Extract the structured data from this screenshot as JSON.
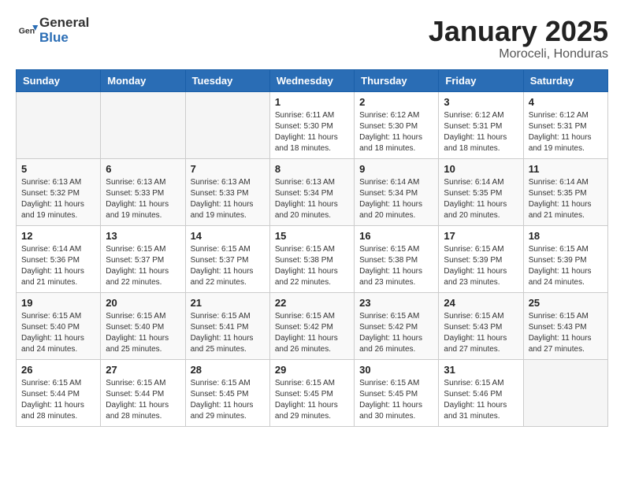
{
  "header": {
    "logo_general": "General",
    "logo_blue": "Blue",
    "month_title": "January 2025",
    "subtitle": "Moroceli, Honduras"
  },
  "weekdays": [
    "Sunday",
    "Monday",
    "Tuesday",
    "Wednesday",
    "Thursday",
    "Friday",
    "Saturday"
  ],
  "weeks": [
    [
      {
        "day": "",
        "info": ""
      },
      {
        "day": "",
        "info": ""
      },
      {
        "day": "",
        "info": ""
      },
      {
        "day": "1",
        "info": "Sunrise: 6:11 AM\nSunset: 5:30 PM\nDaylight: 11 hours and 18 minutes."
      },
      {
        "day": "2",
        "info": "Sunrise: 6:12 AM\nSunset: 5:30 PM\nDaylight: 11 hours and 18 minutes."
      },
      {
        "day": "3",
        "info": "Sunrise: 6:12 AM\nSunset: 5:31 PM\nDaylight: 11 hours and 18 minutes."
      },
      {
        "day": "4",
        "info": "Sunrise: 6:12 AM\nSunset: 5:31 PM\nDaylight: 11 hours and 19 minutes."
      }
    ],
    [
      {
        "day": "5",
        "info": "Sunrise: 6:13 AM\nSunset: 5:32 PM\nDaylight: 11 hours and 19 minutes."
      },
      {
        "day": "6",
        "info": "Sunrise: 6:13 AM\nSunset: 5:33 PM\nDaylight: 11 hours and 19 minutes."
      },
      {
        "day": "7",
        "info": "Sunrise: 6:13 AM\nSunset: 5:33 PM\nDaylight: 11 hours and 19 minutes."
      },
      {
        "day": "8",
        "info": "Sunrise: 6:13 AM\nSunset: 5:34 PM\nDaylight: 11 hours and 20 minutes."
      },
      {
        "day": "9",
        "info": "Sunrise: 6:14 AM\nSunset: 5:34 PM\nDaylight: 11 hours and 20 minutes."
      },
      {
        "day": "10",
        "info": "Sunrise: 6:14 AM\nSunset: 5:35 PM\nDaylight: 11 hours and 20 minutes."
      },
      {
        "day": "11",
        "info": "Sunrise: 6:14 AM\nSunset: 5:35 PM\nDaylight: 11 hours and 21 minutes."
      }
    ],
    [
      {
        "day": "12",
        "info": "Sunrise: 6:14 AM\nSunset: 5:36 PM\nDaylight: 11 hours and 21 minutes."
      },
      {
        "day": "13",
        "info": "Sunrise: 6:15 AM\nSunset: 5:37 PM\nDaylight: 11 hours and 22 minutes."
      },
      {
        "day": "14",
        "info": "Sunrise: 6:15 AM\nSunset: 5:37 PM\nDaylight: 11 hours and 22 minutes."
      },
      {
        "day": "15",
        "info": "Sunrise: 6:15 AM\nSunset: 5:38 PM\nDaylight: 11 hours and 22 minutes."
      },
      {
        "day": "16",
        "info": "Sunrise: 6:15 AM\nSunset: 5:38 PM\nDaylight: 11 hours and 23 minutes."
      },
      {
        "day": "17",
        "info": "Sunrise: 6:15 AM\nSunset: 5:39 PM\nDaylight: 11 hours and 23 minutes."
      },
      {
        "day": "18",
        "info": "Sunrise: 6:15 AM\nSunset: 5:39 PM\nDaylight: 11 hours and 24 minutes."
      }
    ],
    [
      {
        "day": "19",
        "info": "Sunrise: 6:15 AM\nSunset: 5:40 PM\nDaylight: 11 hours and 24 minutes."
      },
      {
        "day": "20",
        "info": "Sunrise: 6:15 AM\nSunset: 5:40 PM\nDaylight: 11 hours and 25 minutes."
      },
      {
        "day": "21",
        "info": "Sunrise: 6:15 AM\nSunset: 5:41 PM\nDaylight: 11 hours and 25 minutes."
      },
      {
        "day": "22",
        "info": "Sunrise: 6:15 AM\nSunset: 5:42 PM\nDaylight: 11 hours and 26 minutes."
      },
      {
        "day": "23",
        "info": "Sunrise: 6:15 AM\nSunset: 5:42 PM\nDaylight: 11 hours and 26 minutes."
      },
      {
        "day": "24",
        "info": "Sunrise: 6:15 AM\nSunset: 5:43 PM\nDaylight: 11 hours and 27 minutes."
      },
      {
        "day": "25",
        "info": "Sunrise: 6:15 AM\nSunset: 5:43 PM\nDaylight: 11 hours and 27 minutes."
      }
    ],
    [
      {
        "day": "26",
        "info": "Sunrise: 6:15 AM\nSunset: 5:44 PM\nDaylight: 11 hours and 28 minutes."
      },
      {
        "day": "27",
        "info": "Sunrise: 6:15 AM\nSunset: 5:44 PM\nDaylight: 11 hours and 28 minutes."
      },
      {
        "day": "28",
        "info": "Sunrise: 6:15 AM\nSunset: 5:45 PM\nDaylight: 11 hours and 29 minutes."
      },
      {
        "day": "29",
        "info": "Sunrise: 6:15 AM\nSunset: 5:45 PM\nDaylight: 11 hours and 29 minutes."
      },
      {
        "day": "30",
        "info": "Sunrise: 6:15 AM\nSunset: 5:45 PM\nDaylight: 11 hours and 30 minutes."
      },
      {
        "day": "31",
        "info": "Sunrise: 6:15 AM\nSunset: 5:46 PM\nDaylight: 11 hours and 31 minutes."
      },
      {
        "day": "",
        "info": ""
      }
    ]
  ]
}
